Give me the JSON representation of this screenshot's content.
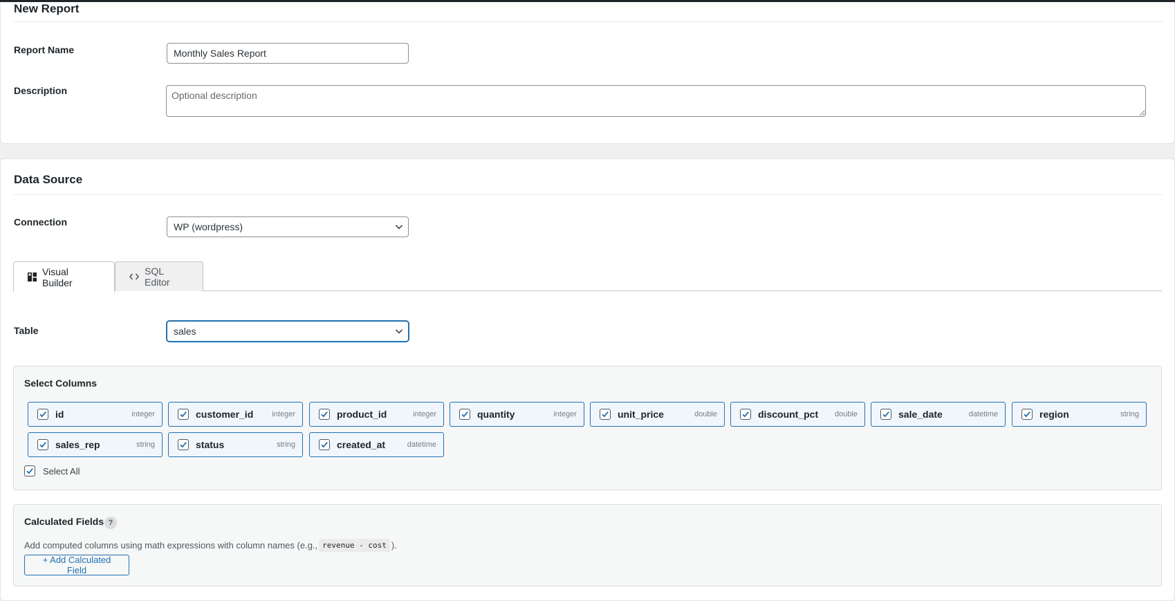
{
  "report_card": {
    "title": "New Report",
    "name_label": "Report Name",
    "name_value": "Monthly Sales Report",
    "description_label": "Description",
    "description_placeholder": "Optional description"
  },
  "data_source": {
    "title": "Data Source",
    "connection_label": "Connection",
    "connection_value": "WP (wordpress)",
    "tabs": [
      {
        "label": "Visual Builder",
        "icon": "grid-layout-icon",
        "active": true
      },
      {
        "label": "SQL Editor",
        "icon": "code-brackets-icon",
        "active": false
      }
    ],
    "table_label": "Table",
    "table_value": "sales"
  },
  "select_columns": {
    "title": "Select Columns",
    "columns": [
      {
        "name": "id",
        "type": "integer",
        "checked": true
      },
      {
        "name": "customer_id",
        "type": "integer",
        "checked": true
      },
      {
        "name": "product_id",
        "type": "integer",
        "checked": true
      },
      {
        "name": "quantity",
        "type": "integer",
        "checked": true
      },
      {
        "name": "unit_price",
        "type": "double",
        "checked": true
      },
      {
        "name": "discount_pct",
        "type": "double",
        "checked": true
      },
      {
        "name": "sale_date",
        "type": "datetime",
        "checked": true
      },
      {
        "name": "region",
        "type": "string",
        "checked": true
      },
      {
        "name": "sales_rep",
        "type": "string",
        "checked": true
      },
      {
        "name": "status",
        "type": "string",
        "checked": true
      },
      {
        "name": "created_at",
        "type": "datetime",
        "checked": true
      }
    ],
    "select_all_label": "Select All",
    "select_all_checked": true
  },
  "calculated_fields": {
    "title": "Calculated Fields",
    "help_icon": "?",
    "description_before": "Add computed columns using math expressions with column names (e.g.,",
    "example_code": "revenue - cost",
    "description_after": ").",
    "add_button_label": "+ Add Calculated Field"
  },
  "colors": {
    "accent": "#2271b1",
    "chip_bg": "#f0f6fc",
    "panel_bg": "#f6f7f7"
  }
}
